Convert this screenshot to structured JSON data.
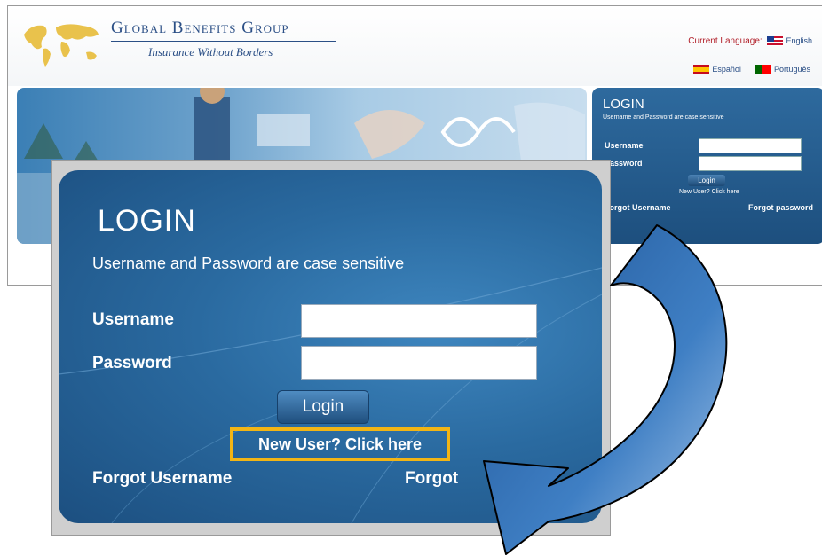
{
  "header": {
    "brand_name": "Global Benefits Group",
    "tagline": "Insurance Without Borders",
    "current_language_label": "Current Language:",
    "current_language": "English",
    "languages": [
      {
        "label": "Español",
        "flag": "flag-es-icon"
      },
      {
        "label": "Português",
        "flag": "flag-pt-icon"
      }
    ]
  },
  "mini_login": {
    "title": "LOGIN",
    "note": "Username and Password are case sensitive",
    "username_label": "Username",
    "password_label": "Password",
    "login_button": "Login",
    "new_user_link": "New User? Click here",
    "forgot_username": "Forgot Username",
    "forgot_password": "Forgot password"
  },
  "zoom_login": {
    "title": "LOGIN",
    "note": "Username and Password are case sensitive",
    "username_label": "Username",
    "password_label": "Password",
    "username_value": "",
    "password_value": "",
    "login_button": "Login",
    "new_user_link": "New User? Click here",
    "forgot_username": "Forgot Username",
    "forgot_password_visible": "Forgot"
  },
  "colors": {
    "brand": "#2b4f86",
    "panel": "#2a6aa0",
    "highlight": "#f2b515",
    "arrow": "#2e68ad"
  }
}
